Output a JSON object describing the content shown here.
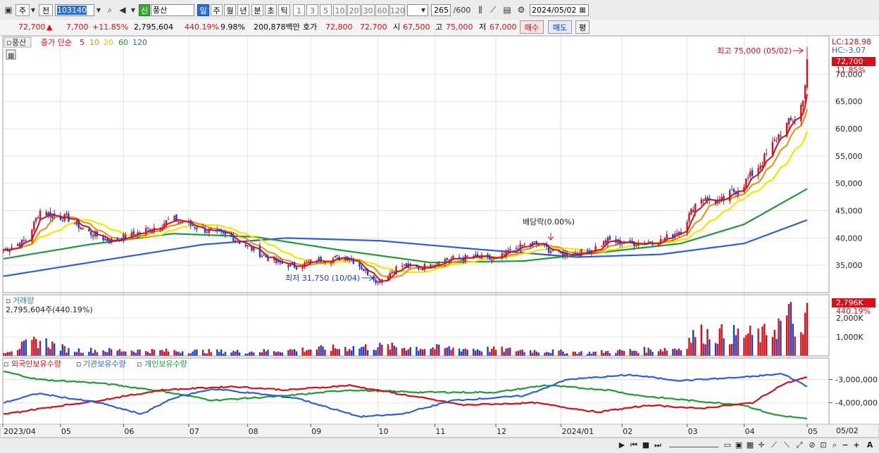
{
  "toolbar": {
    "period_label": "주",
    "code_type_label": "전",
    "stock_code": "103140",
    "credit_badge": "신",
    "stock_name": "풍산",
    "interval_tabs": [
      "일",
      "주",
      "월",
      "년",
      "분",
      "초",
      "틱"
    ],
    "active_interval": "일",
    "minute_options": [
      "1",
      "3",
      "5",
      "10",
      "20",
      "30",
      "60",
      "120"
    ],
    "count_value": "265",
    "count_total": "/600",
    "date": "2024/05/02"
  },
  "quote": {
    "price": "72,700",
    "change_arrow": "▲",
    "change": "7,700",
    "change_pct": "+11.85%",
    "volume": "2,795,604",
    "volume_ratio": "440.19%",
    "turnover_rate": "9.98%",
    "trade_value": "200,878백만",
    "bid_label": "호가",
    "bid": "72,800",
    "ask": "72,700",
    "open_label": "시",
    "open": "67,500",
    "high_label": "고",
    "high": "75,000",
    "low_label": "저",
    "low": "67,000",
    "buy_label": "매수",
    "sell_label": "매도",
    "eval_label": "평"
  },
  "legend": {
    "name": "풍산",
    "ma_label": "종가 단순",
    "periods": [
      "5",
      "10",
      "20",
      "60",
      "120"
    ]
  },
  "price_panel": {
    "lc": "LC:128.98",
    "hc": "HC:-3.07",
    "current_price_tag": "72,700",
    "current_pct_tag": "11.85%",
    "high_annotation": "최고 75,000 (05/02)",
    "low_annotation": "최저 31,750 (10/04)",
    "dividend_annotation": "배당락(0.00%)"
  },
  "volume_panel": {
    "title": "거래량",
    "subtitle": "2,795,604주(440.19%)",
    "tag_value": "2,796K",
    "tag_pct": "440.19%"
  },
  "holdings_panel": {
    "series_names": [
      "외국인보유수량",
      "기관보유수량",
      "개인보유수량"
    ]
  },
  "x_axis_labels": [
    "2023/04",
    "05",
    "06",
    "07",
    "08",
    "09",
    "10",
    "11",
    "12",
    "2024/01",
    "02",
    "03",
    "04",
    "05"
  ],
  "x_axis_end_label": "05/02",
  "colors": {
    "up": "#d4101a",
    "down": "#1a3fd0",
    "ma5": "#d4101a",
    "ma10": "#f08c00",
    "ma20": "#f5e600",
    "ma60": "#1f9a3a",
    "ma120": "#2e5fd6",
    "foreign": "#1f9a3a",
    "institution": "#d4101a",
    "individual": "#2e5fd6"
  },
  "chart_data": [
    {
      "type": "candlestick",
      "title": "풍산",
      "ylim": [
        30000,
        77000
      ],
      "y_ticks": [
        35000,
        40000,
        45000,
        50000,
        55000,
        60000,
        65000,
        70000
      ],
      "y_tick_labels": [
        "35,000",
        "40,000",
        "45,000",
        "50,000",
        "55,000",
        "60,000",
        "65,000",
        "70,000"
      ],
      "close_anchors": [
        {
          "x": "2023-04-03",
          "y": 37800
        },
        {
          "x": "2023-04-14",
          "y": 39500
        },
        {
          "x": "2023-04-21",
          "y": 45000
        },
        {
          "x": "2023-04-28",
          "y": 44000
        },
        {
          "x": "2023-05-05",
          "y": 43500
        },
        {
          "x": "2023-05-15",
          "y": 41000
        },
        {
          "x": "2023-05-25",
          "y": 39500
        },
        {
          "x": "2023-06-05",
          "y": 40500
        },
        {
          "x": "2023-06-15",
          "y": 41800
        },
        {
          "x": "2023-06-25",
          "y": 43500
        },
        {
          "x": "2023-07-03",
          "y": 42500
        },
        {
          "x": "2023-07-15",
          "y": 41000
        },
        {
          "x": "2023-07-25",
          "y": 40000
        },
        {
          "x": "2023-08-03",
          "y": 38000
        },
        {
          "x": "2023-08-15",
          "y": 35500
        },
        {
          "x": "2023-08-25",
          "y": 34800
        },
        {
          "x": "2023-09-05",
          "y": 36000
        },
        {
          "x": "2023-09-20",
          "y": 36500
        },
        {
          "x": "2023-10-04",
          "y": 32000
        },
        {
          "x": "2023-10-15",
          "y": 35000
        },
        {
          "x": "2023-10-25",
          "y": 34500
        },
        {
          "x": "2023-11-05",
          "y": 36000
        },
        {
          "x": "2023-11-20",
          "y": 36500
        },
        {
          "x": "2023-12-01",
          "y": 36000
        },
        {
          "x": "2023-12-10",
          "y": 38000
        },
        {
          "x": "2023-12-20",
          "y": 39000
        },
        {
          "x": "2024-01-02",
          "y": 37000
        },
        {
          "x": "2024-01-15",
          "y": 37500
        },
        {
          "x": "2024-01-25",
          "y": 39500
        },
        {
          "x": "2024-02-05",
          "y": 39000
        },
        {
          "x": "2024-02-20",
          "y": 39500
        },
        {
          "x": "2024-03-01",
          "y": 41500
        },
        {
          "x": "2024-03-10",
          "y": 47500
        },
        {
          "x": "2024-03-20",
          "y": 46500
        },
        {
          "x": "2024-04-01",
          "y": 50000
        },
        {
          "x": "2024-04-10",
          "y": 54000
        },
        {
          "x": "2024-04-20",
          "y": 60000
        },
        {
          "x": "2024-04-26",
          "y": 62000
        },
        {
          "x": "2024-04-30",
          "y": 65000
        },
        {
          "x": "2024-05-02",
          "y": 72700
        }
      ],
      "ma60_anchors": [
        {
          "x": "2023-04-03",
          "y": 36200
        },
        {
          "x": "2023-05-15",
          "y": 38800
        },
        {
          "x": "2023-06-25",
          "y": 40800
        },
        {
          "x": "2023-08-05",
          "y": 40200
        },
        {
          "x": "2023-09-15",
          "y": 37800
        },
        {
          "x": "2023-10-30",
          "y": 35500
        },
        {
          "x": "2023-12-15",
          "y": 35800
        },
        {
          "x": "2024-01-25",
          "y": 37500
        },
        {
          "x": "2024-03-01",
          "y": 39000
        },
        {
          "x": "2024-04-01",
          "y": 42500
        },
        {
          "x": "2024-05-02",
          "y": 49000
        }
      ],
      "ma120_anchors": [
        {
          "x": "2023-04-03",
          "y": 33000
        },
        {
          "x": "2023-05-20",
          "y": 35800
        },
        {
          "x": "2023-07-10",
          "y": 38800
        },
        {
          "x": "2023-08-20",
          "y": 40000
        },
        {
          "x": "2023-10-05",
          "y": 39500
        },
        {
          "x": "2023-11-20",
          "y": 38000
        },
        {
          "x": "2024-01-10",
          "y": 36500
        },
        {
          "x": "2024-02-20",
          "y": 37000
        },
        {
          "x": "2024-04-01",
          "y": 39000
        },
        {
          "x": "2024-05-02",
          "y": 43300
        }
      ],
      "annotations": [
        {
          "label": "최고 75,000 (05/02)",
          "x": "2024-05-02",
          "y": 75000
        },
        {
          "label": "최저 31,750 (10/04)",
          "x": "2023-10-04",
          "y": 31750
        },
        {
          "label": "배당락(0.00%)",
          "x": "2023-12-27",
          "y": 40500
        }
      ]
    },
    {
      "type": "bar",
      "title": "거래량",
      "ylim": [
        0,
        3000000
      ],
      "y_tick_labels": [
        "1,000K",
        "2,000K"
      ],
      "y_ticks": [
        1000000,
        2000000
      ],
      "volume_anchors": [
        {
          "x": "2023-04-03",
          "y": 250000
        },
        {
          "x": "2023-04-21",
          "y": 900000
        },
        {
          "x": "2023-05-05",
          "y": 350000
        },
        {
          "x": "2023-06-20",
          "y": 300000
        },
        {
          "x": "2023-08-01",
          "y": 250000
        },
        {
          "x": "2023-10-04",
          "y": 550000
        },
        {
          "x": "2023-12-10",
          "y": 350000
        },
        {
          "x": "2024-01-15",
          "y": 200000
        },
        {
          "x": "2024-03-01",
          "y": 450000
        },
        {
          "x": "2024-03-08",
          "y": 1300000
        },
        {
          "x": "2024-04-10",
          "y": 1200000
        },
        {
          "x": "2024-04-24",
          "y": 2300000
        },
        {
          "x": "2024-04-30",
          "y": 900000
        },
        {
          "x": "2024-05-02",
          "y": 2795604
        }
      ]
    },
    {
      "type": "line",
      "title": "외국인보유수량 / 기관보유수량 / 개인보유수량",
      "ylim": [
        -4800000,
        -2500000
      ],
      "y_ticks": [
        -3000000,
        -4000000
      ],
      "y_tick_labels": [
        "-3,000,000",
        "-4,000,000"
      ],
      "series": [
        {
          "name": "외국인보유수량",
          "anchors": [
            {
              "x": "2023-04-03",
              "y": -2650000
            },
            {
              "x": "2023-04-20",
              "y": -3000000
            },
            {
              "x": "2023-05-20",
              "y": -3150000
            },
            {
              "x": "2023-06-20",
              "y": -3500000
            },
            {
              "x": "2023-07-15",
              "y": -3900000
            },
            {
              "x": "2023-08-20",
              "y": -3700000
            },
            {
              "x": "2023-09-20",
              "y": -3450000
            },
            {
              "x": "2023-10-25",
              "y": -3550000
            },
            {
              "x": "2023-12-01",
              "y": -3550000
            },
            {
              "x": "2023-12-25",
              "y": -3250000
            },
            {
              "x": "2024-01-25",
              "y": -3450000
            },
            {
              "x": "2024-02-10",
              "y": -3700000
            },
            {
              "x": "2024-03-05",
              "y": -3900000
            },
            {
              "x": "2024-04-01",
              "y": -4100000
            },
            {
              "x": "2024-04-15",
              "y": -4500000
            },
            {
              "x": "2024-05-02",
              "y": -4700000
            }
          ]
        },
        {
          "name": "기관보유수량",
          "anchors": [
            {
              "x": "2023-04-03",
              "y": -4500000
            },
            {
              "x": "2023-04-25",
              "y": -4200000
            },
            {
              "x": "2023-05-20",
              "y": -3900000
            },
            {
              "x": "2023-06-20",
              "y": -3450000
            },
            {
              "x": "2023-07-25",
              "y": -3300000
            },
            {
              "x": "2023-08-20",
              "y": -3450000
            },
            {
              "x": "2023-09-20",
              "y": -3250000
            },
            {
              "x": "2023-10-20",
              "y": -3700000
            },
            {
              "x": "2023-11-15",
              "y": -4100000
            },
            {
              "x": "2023-12-20",
              "y": -4000000
            },
            {
              "x": "2024-01-20",
              "y": -4400000
            },
            {
              "x": "2024-02-15",
              "y": -4100000
            },
            {
              "x": "2024-03-10",
              "y": -4250000
            },
            {
              "x": "2024-04-05",
              "y": -4000000
            },
            {
              "x": "2024-04-20",
              "y": -3200000
            },
            {
              "x": "2024-05-02",
              "y": -2900000
            }
          ]
        },
        {
          "name": "개인보유수량",
          "anchors": [
            {
              "x": "2023-04-03",
              "y": -4000000
            },
            {
              "x": "2023-04-20",
              "y": -3600000
            },
            {
              "x": "2023-05-20",
              "y": -4000000
            },
            {
              "x": "2023-06-10",
              "y": -4500000
            },
            {
              "x": "2023-06-25",
              "y": -3800000
            },
            {
              "x": "2023-07-15",
              "y": -3400000
            },
            {
              "x": "2023-08-25",
              "y": -3800000
            },
            {
              "x": "2023-09-25",
              "y": -4600000
            },
            {
              "x": "2023-10-15",
              "y": -4500000
            },
            {
              "x": "2023-11-10",
              "y": -3900000
            },
            {
              "x": "2023-12-15",
              "y": -3700000
            },
            {
              "x": "2024-01-05",
              "y": -3000000
            },
            {
              "x": "2024-02-05",
              "y": -2800000
            },
            {
              "x": "2024-03-01",
              "y": -3050000
            },
            {
              "x": "2024-04-01",
              "y": -2900000
            },
            {
              "x": "2024-04-20",
              "y": -2750000
            },
            {
              "x": "2024-05-02",
              "y": -3300000
            }
          ]
        }
      ]
    }
  ]
}
